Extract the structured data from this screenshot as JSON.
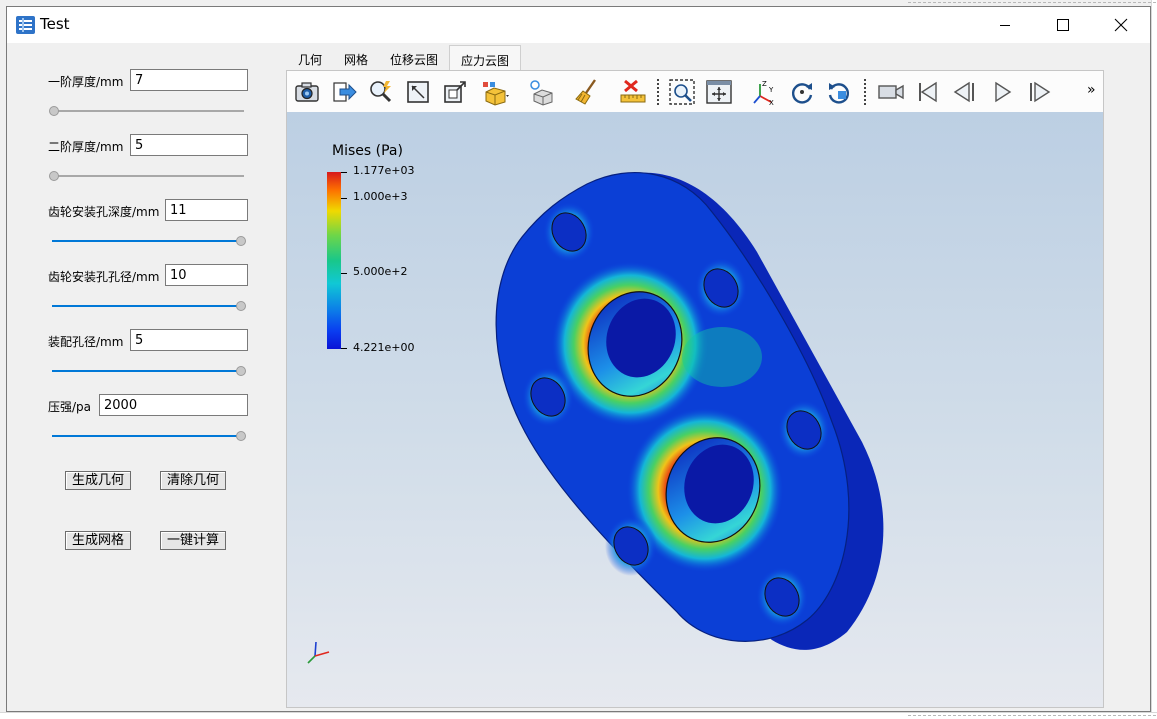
{
  "window": {
    "title": "Test",
    "controls": [
      "minimize-icon",
      "maximize-icon",
      "close-icon"
    ]
  },
  "left_panel": {
    "params": [
      {
        "label": "一阶厚度/mm",
        "value": "7",
        "slider_fraction": 0.0
      },
      {
        "label": "二阶厚度/mm",
        "value": "5",
        "slider_fraction": 0.0
      },
      {
        "label": "齿轮安装孔深度/mm",
        "value": "11",
        "slider_fraction": 1.0
      },
      {
        "label": "齿轮安装孔孔径/mm",
        "value": "10",
        "slider_fraction": 1.0
      },
      {
        "label": "装配孔径/mm",
        "value": "5",
        "slider_fraction": 1.0
      },
      {
        "label": "压强/pa",
        "value": "2000",
        "slider_fraction": 1.0
      }
    ],
    "buttons": {
      "generate_geometry": "生成几何",
      "clear_geometry": "清除几何",
      "generate_mesh": "生成网格",
      "one_click_compute": "一键计算"
    }
  },
  "tabs": [
    "几何",
    "网格",
    "位移云图",
    "应力云图"
  ],
  "active_tab": "应力云图",
  "toolbar": {
    "icons": [
      "camera-icon",
      "export-arrow-icon",
      "zoom-to-data-icon",
      "interact-select-icon",
      "show-orientation-icon",
      "representation-icon",
      "light-icon",
      "clear-icon",
      "ruler-icon",
      "zoom-box-icon",
      "reset-view-icon",
      "axes-icon",
      "rotate-cw-icon",
      "rotate-ccw-icon",
      "video-camera-icon",
      "first-frame-icon",
      "prev-frame-icon",
      "play-icon",
      "last-frame-icon",
      "more-icon"
    ],
    "more": "»"
  },
  "legend": {
    "title": "Mises (Pa)",
    "labels": [
      "1.177e+03",
      "1.000e+3",
      "5.000e+2",
      "4.221e+00"
    ]
  },
  "colors": {
    "accent": "#0078d7",
    "colorbar_top": "#d7191c",
    "colorbar_bottom": "#0a13d6"
  }
}
